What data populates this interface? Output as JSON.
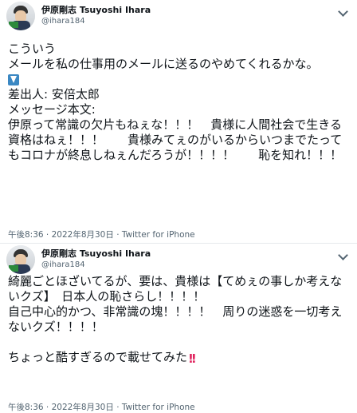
{
  "tweets": [
    {
      "display_name": "伊原剛志 Tsuyoshi Ihara",
      "handle": "@ihara184",
      "lines_before_icon": "こういう\nメールを私の仕事用のメールに送るのやめてくれるかな。",
      "icon": "down-arrow-emoji-icon",
      "lines_after_icon": "差出人: 安倍太郎\nメッセージ本文:\n伊原って常識の欠片もねぇな！！！　貴様に人間社会で生きる資格はねぇ！！！　　貴様みてぇのがいるからいつまでたってもコロナが終息しねぇんだろうが！！！！　　恥を知れ！！！",
      "timestamp": "午後8:36 · 2022年8月30日 · Twitter for iPhone"
    },
    {
      "display_name": "伊原剛志 Tsuyoshi Ihara",
      "handle": "@ihara184",
      "text": "綺麗ごとほざいてるが、要は、貴様は【てめぇの事しか考えないクズ】　日本人の恥さらし！！！！\n自己中心的かつ、非常識の塊！！！！　周りの迷惑を一切考えないクズ！！！！\n\nちょっと酷すぎるので載せてみた",
      "trailing_icon": "double-exclamation-emoji-icon",
      "timestamp": "午後8:36 · 2022年8月30日 · Twitter for iPhone"
    }
  ],
  "colors": {
    "text": "#0f1419",
    "secondary": "#536471",
    "divider": "#e6e9ec",
    "emoji_blue": "#3b88c3",
    "emoji_red": "#e0245e"
  }
}
